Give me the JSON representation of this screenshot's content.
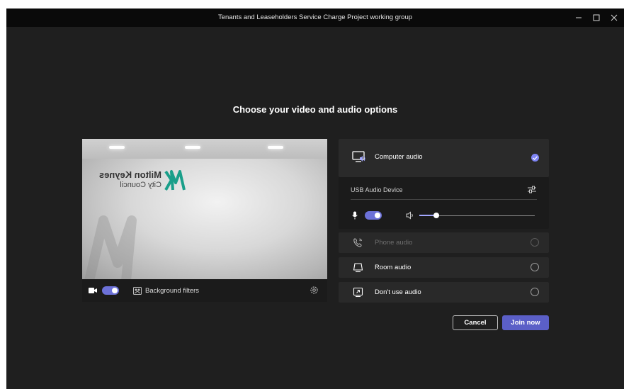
{
  "window": {
    "title": "Tenants and Leaseholders Service Charge Project working group",
    "controls": [
      "minimize-icon",
      "maximize-icon",
      "close-icon"
    ]
  },
  "heading": "Choose your video and audio options",
  "video": {
    "camera_on": true,
    "background_filters_label": "Background filters",
    "preview_logo": {
      "line1": "Milton Keynes",
      "line2": "City Council"
    }
  },
  "audio": {
    "computer_audio": {
      "label": "Computer audio",
      "selected": true,
      "device": "USB Audio Device",
      "mic_on": true,
      "speaker_volume": 0.15
    },
    "options": [
      {
        "label": "Phone audio",
        "icon": "phone-audio-icon",
        "disabled": true,
        "selected": false
      },
      {
        "label": "Room audio",
        "icon": "room-audio-icon",
        "disabled": false,
        "selected": false
      },
      {
        "label": "Don't use audio",
        "icon": "no-audio-icon",
        "disabled": false,
        "selected": false
      }
    ]
  },
  "actions": {
    "cancel_label": "Cancel",
    "join_label": "Join now"
  },
  "colors": {
    "accent": "#5b5fc7",
    "toggle_on": "#6c71d8",
    "background": "#1f1f1f",
    "panel": "#292929"
  }
}
